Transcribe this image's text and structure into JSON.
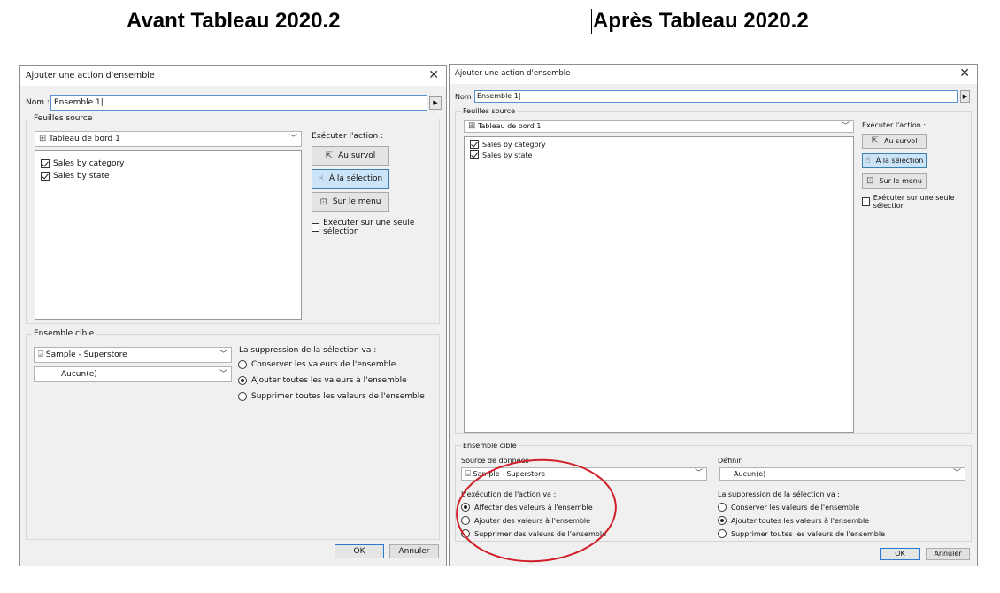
{
  "headers": {
    "before": "Avant Tableau 2020.2",
    "after": "Après Tableau 2020.2"
  },
  "dialog": {
    "title": "Ajouter une action d'ensemble",
    "close_glyph": "✕",
    "name_label": "Nom :",
    "name_value": "Ensemble 1",
    "source_sheets_label": "Feuilles source",
    "dashboard": "Tableau de bord 1",
    "sheets": [
      "Sales by category",
      "Sales by state"
    ],
    "run_action_label_before": "Exécuter l'action :",
    "run_action_label_after": "Exécuter l'action :",
    "actions": {
      "hover": "Au survol",
      "select": "À la sélection",
      "menu": "Sur le menu"
    },
    "single_select": "Exécuter sur une seule sélection",
    "target_set_label": "Ensemble cible",
    "datasource_label": "Source de données",
    "datasource": "Sample - Superstore",
    "define_label": "Définir",
    "set_value": "Aucun(e)",
    "run_effect_label": "L'exécution de l'action va :",
    "run_effect_options": [
      "Affecter des valeurs à l'ensemble",
      "Ajouter des valeurs à l'ensemble",
      "Supprimer des valeurs de l'ensemble"
    ],
    "clear_label": "La suppression de la sélection va :",
    "clear_options": [
      "Conserver les valeurs de l'ensemble",
      "Ajouter toutes les valeurs à l'ensemble",
      "Supprimer toutes les valeurs de l'ensemble"
    ],
    "ok": "OK",
    "cancel": "Annuler"
  },
  "colors": {
    "annotation": "#d0202a",
    "selected_button": "#cce4f7",
    "dialog_body": "#f0f0f0"
  }
}
